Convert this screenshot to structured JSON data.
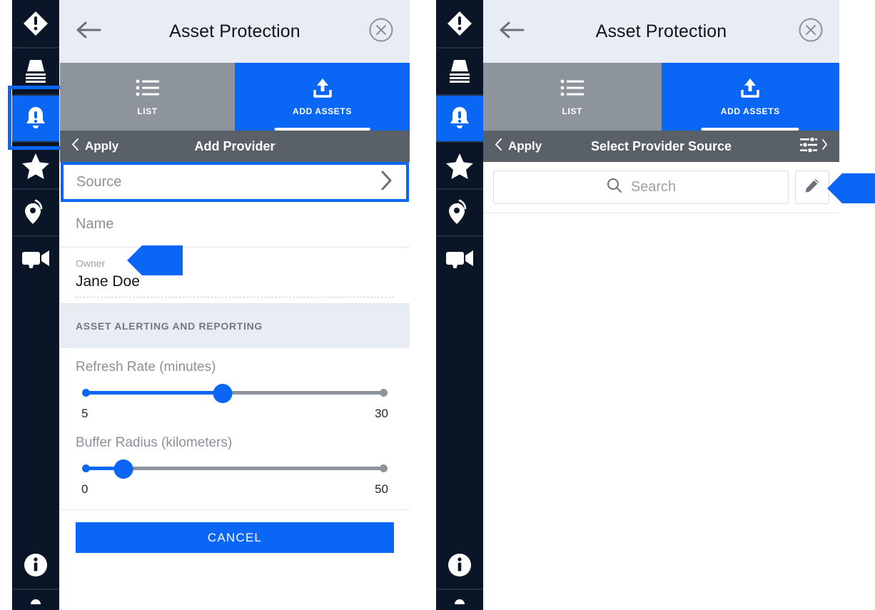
{
  "rail": {
    "items": [
      {
        "name": "alert-diamond-icon",
        "label": "Alerts",
        "active": false
      },
      {
        "name": "layers-icon",
        "label": "Layers",
        "active": false
      },
      {
        "name": "bell-alert-icon",
        "label": "Notifications",
        "active": true
      },
      {
        "name": "star-icon",
        "label": "Favorites",
        "active": false
      },
      {
        "name": "location-signal-icon",
        "label": "Tracking",
        "active": false
      },
      {
        "name": "video-camera-icon",
        "label": "Cameras",
        "active": false
      }
    ],
    "bottom_item": {
      "name": "info-icon",
      "label": "Information"
    }
  },
  "left_panel": {
    "header": {
      "back_icon": "arrow-left-icon",
      "title": "Asset Protection",
      "close_icon": "close-circle-icon"
    },
    "tabs": [
      {
        "label": "LIST",
        "icon": "list-icon",
        "active": false
      },
      {
        "label": "ADD ASSETS",
        "icon": "upload-icon",
        "active": true
      }
    ],
    "subbar": {
      "back_chevron": "chevron-left-icon",
      "apply_label": "Apply",
      "title": "Add Provider"
    },
    "form": {
      "source": {
        "label": "Source",
        "value": "",
        "chevron": "chevron-right-icon"
      },
      "name": {
        "label": "Name",
        "value": ""
      },
      "owner": {
        "label": "Owner",
        "value": "Jane Doe"
      },
      "section_title": "ASSET ALERTING AND REPORTING",
      "sliders": [
        {
          "label": "Refresh Rate (minutes)",
          "min": "5",
          "max": "30",
          "percent": 46
        },
        {
          "label": "Buffer Radius (kilometers)",
          "min": "0",
          "max": "50",
          "percent": 13
        }
      ],
      "cancel_label": "CANCEL"
    }
  },
  "right_panel": {
    "header": {
      "back_icon": "arrow-left-icon",
      "title": "Asset Protection",
      "close_icon": "close-circle-icon"
    },
    "tabs": [
      {
        "label": "LIST",
        "icon": "list-icon",
        "active": false
      },
      {
        "label": "ADD ASSETS",
        "icon": "upload-icon",
        "active": true
      }
    ],
    "subbar": {
      "back_chevron": "chevron-left-icon",
      "apply_label": "Apply",
      "title": "Select Provider Source",
      "filter_icon": "sliders-filter-icon",
      "forward_chevron": "chevron-right-icon"
    },
    "search": {
      "icon": "search-icon",
      "placeholder": "Search",
      "value": "",
      "edit_icon": "pencil-icon"
    }
  },
  "colors": {
    "accent_blue": "#0a66f5",
    "rail_dark": "#0a1628",
    "header_bg": "#e8edf3",
    "tab_inactive": "#8e949c",
    "subbar_bg": "#5a6068"
  }
}
